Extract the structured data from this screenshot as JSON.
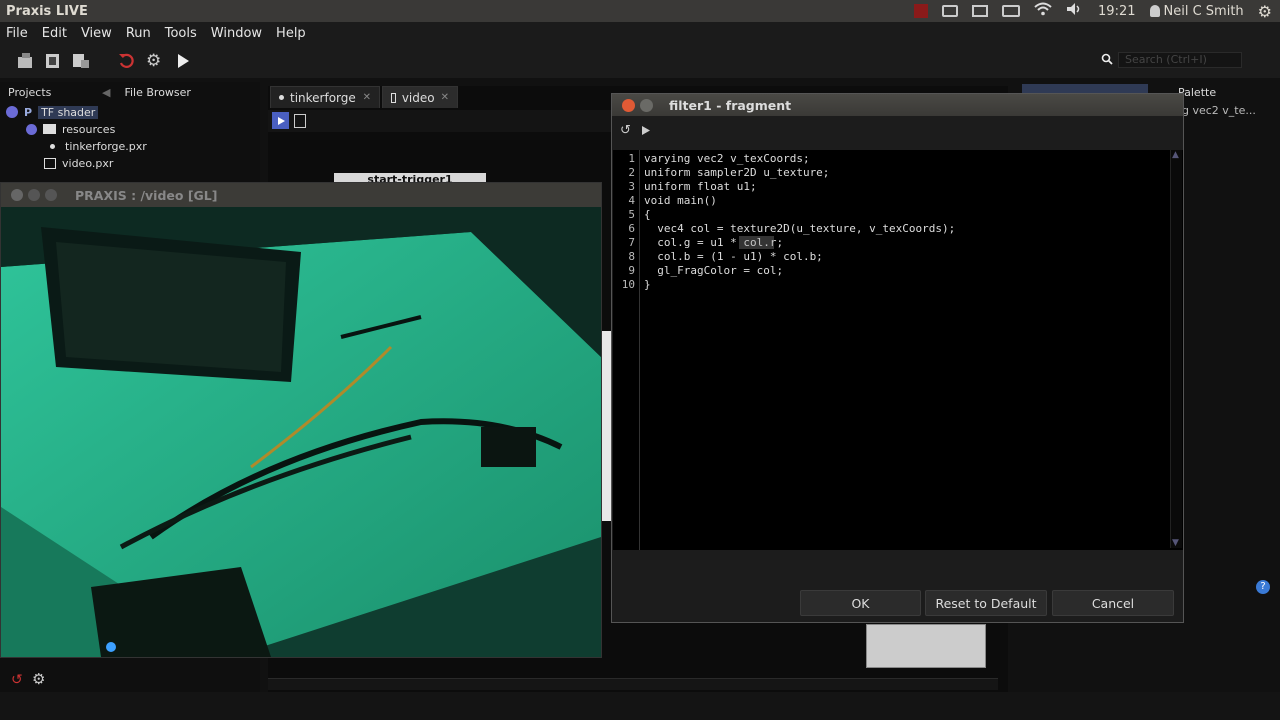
{
  "top_panel": {
    "app_title": "Praxis LIVE",
    "time": "19:21",
    "user": "Neil C Smith"
  },
  "menu": {
    "items": [
      "File",
      "Edit",
      "View",
      "Run",
      "Tools",
      "Window",
      "Help"
    ]
  },
  "toolbar": {
    "search_placeholder": "Search (Ctrl+I)"
  },
  "left_panel": {
    "tab_projects": "Projects",
    "tab_file_browser": "File Browser",
    "tree": {
      "root": "TF shader",
      "resources": "resources",
      "file1": "tinkerforge.pxr",
      "file2": "video.pxr"
    }
  },
  "editor_tabs": {
    "tab1": "tinkerforge",
    "tab2": "video"
  },
  "canvas_node": {
    "label": "start-trigger1"
  },
  "right_panel": {
    "tab_partial": "Palette",
    "item_partial": "g vec2 v_te..."
  },
  "video_window": {
    "title": "PRAXIS : /video [GL]"
  },
  "dialog": {
    "title": "filter1 - fragment",
    "line_numbers": [
      "1",
      "2",
      "3",
      "4",
      "5",
      "6",
      "7",
      "8",
      "9",
      "10"
    ],
    "code": [
      "varying vec2 v_texCoords;",
      "uniform sampler2D u_texture;",
      "uniform float u1;",
      "void main()",
      "{",
      "  vec4 col = texture2D(u_texture, v_texCoords);",
      "  col.g = u1 * col.r;",
      "  col.b = (1 - u1) * col.b;",
      "  gl_FragColor = col;",
      "}"
    ],
    "ok": "OK",
    "reset": "Reset to Default",
    "cancel": "Cancel"
  },
  "colors": {
    "video_green": "#1e8a69",
    "selection": "#2f3a55",
    "close_btn": "#e05a35"
  }
}
